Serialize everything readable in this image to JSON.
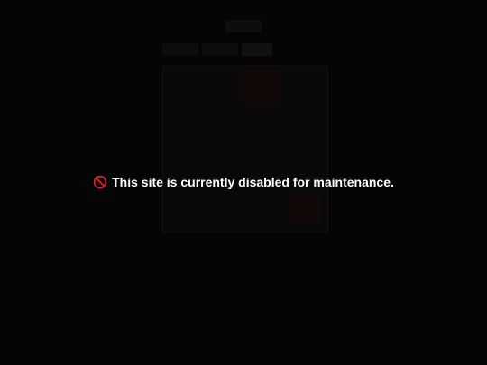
{
  "maintenance": {
    "icon": "prohibited-icon",
    "icon_color": "#e0202e",
    "message": "This site is currently disabled for maintenance."
  },
  "colors": {
    "background": "#050505",
    "text": "#ffffff"
  }
}
